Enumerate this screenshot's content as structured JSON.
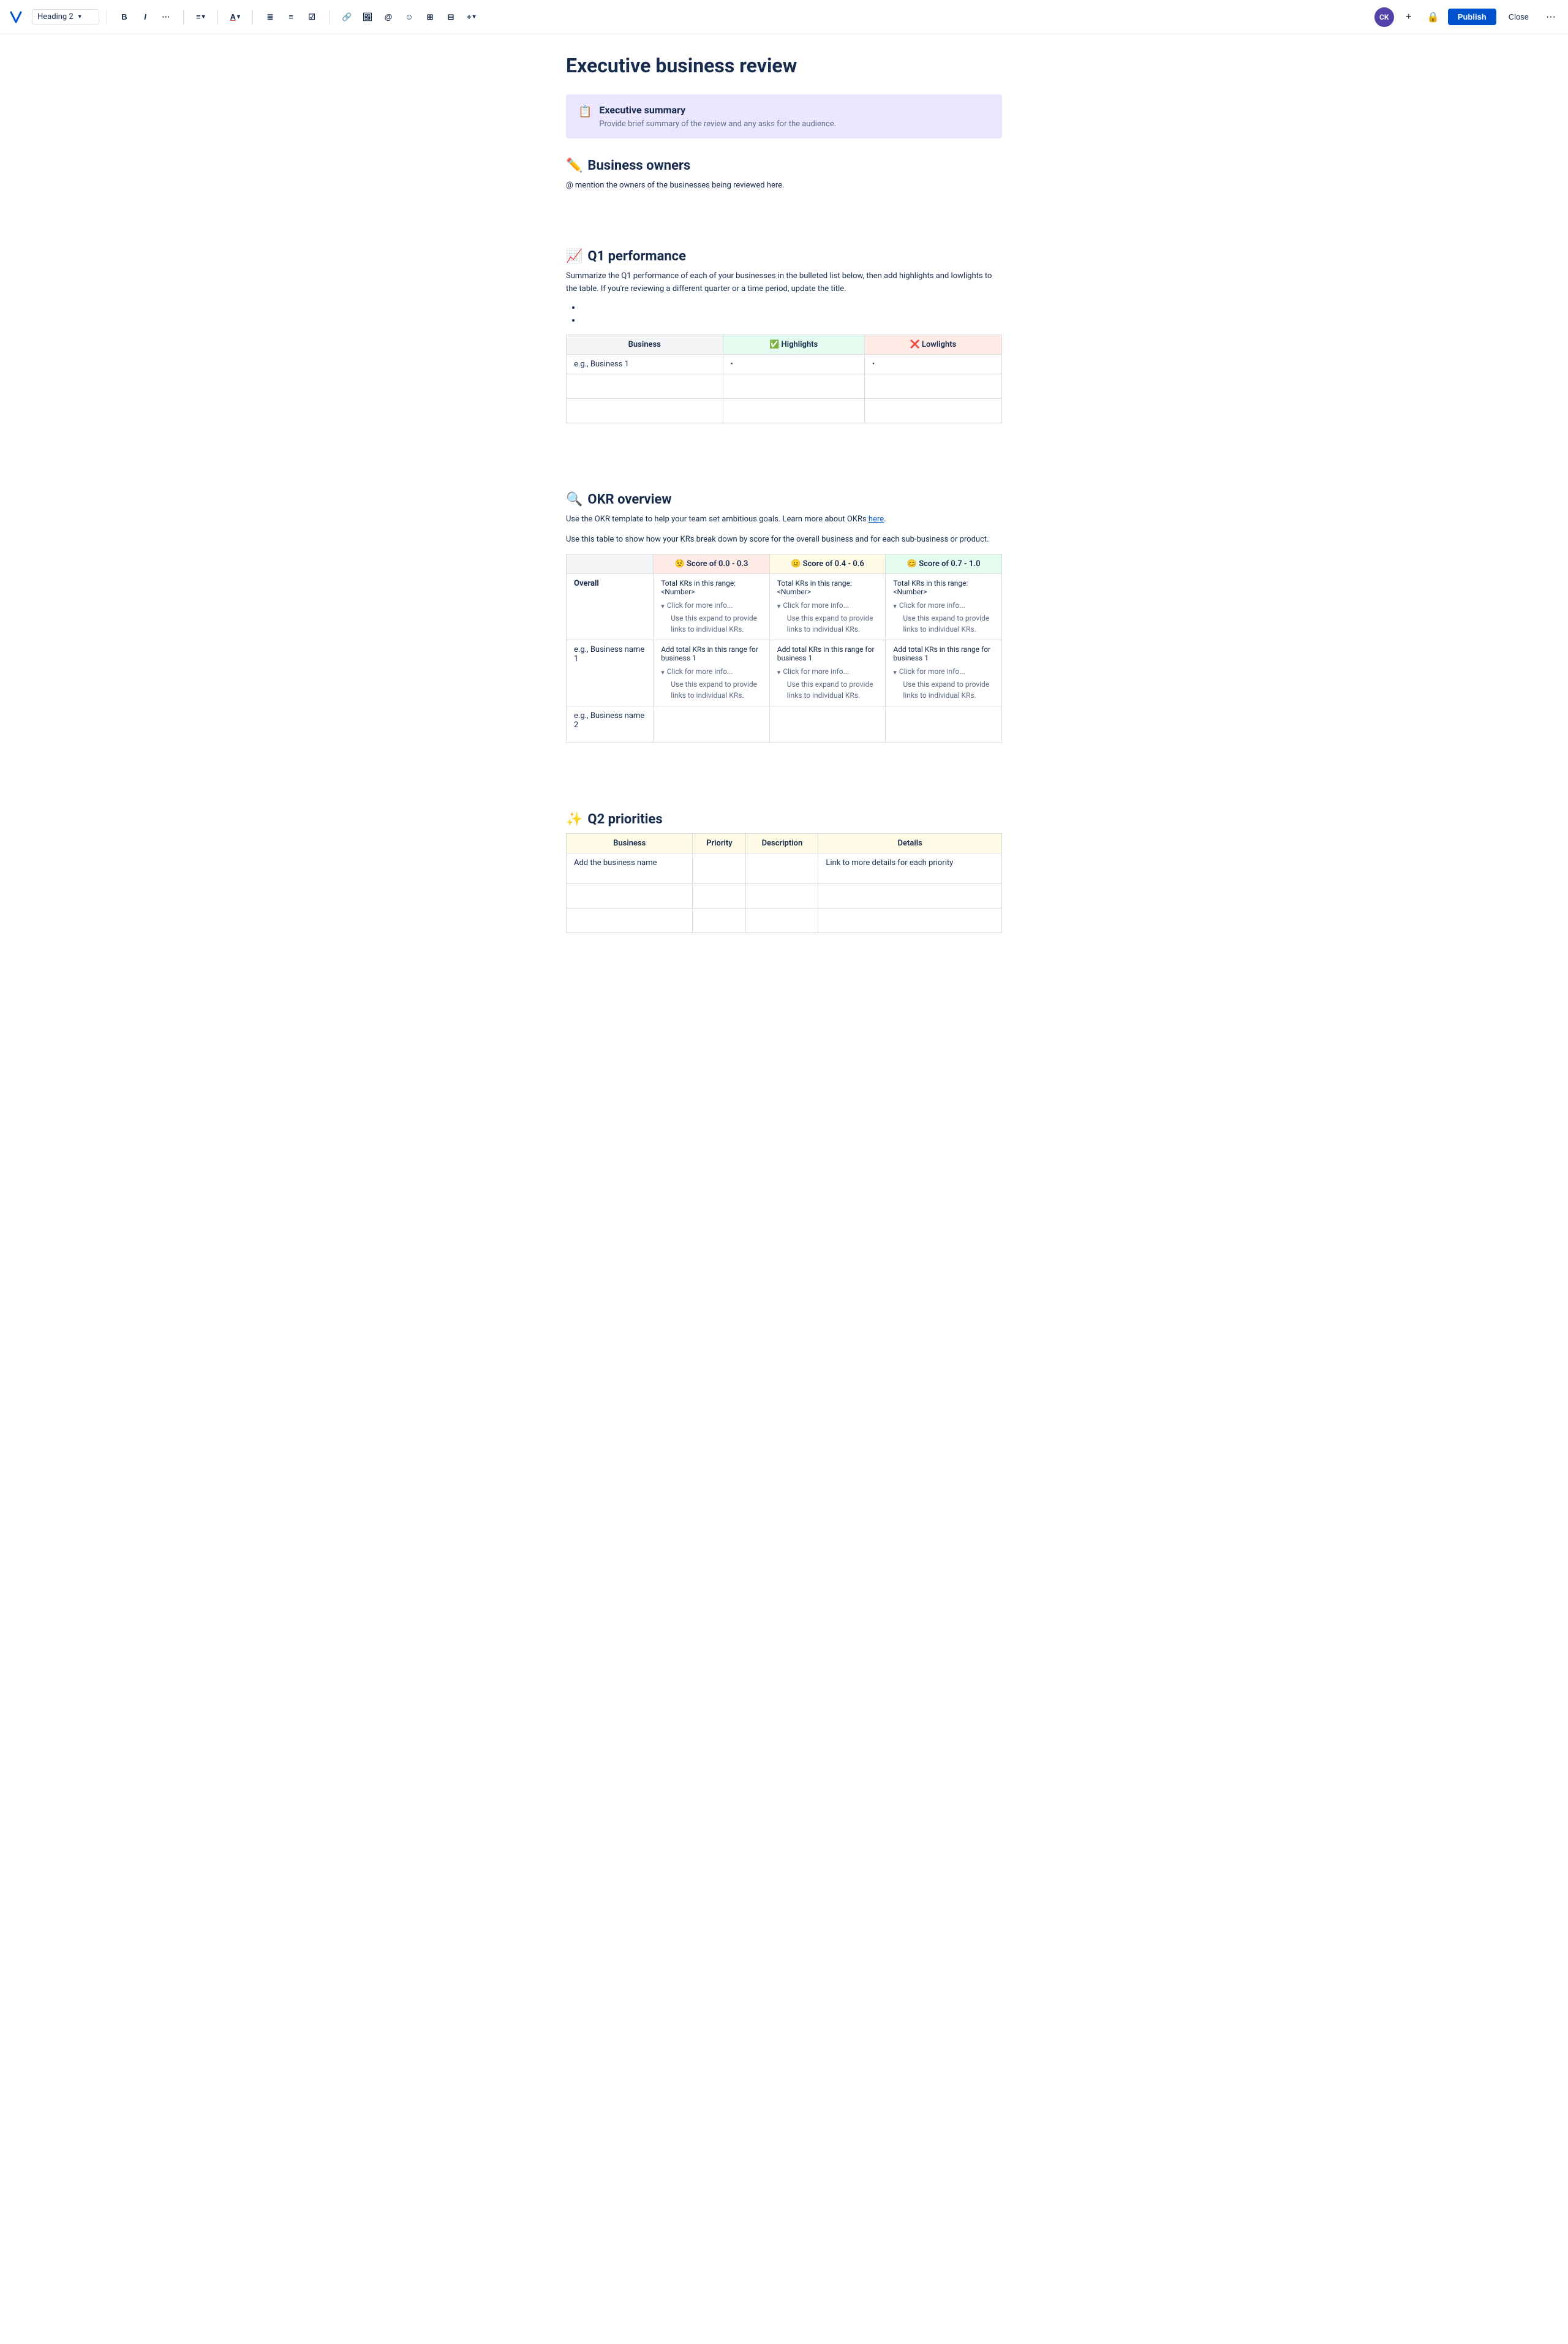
{
  "toolbar": {
    "heading_selector": "Heading 2",
    "bold": "B",
    "italic": "I",
    "more_text": "···",
    "align": "≡",
    "text_color": "A",
    "bullet_list": "≡",
    "numbered_list": "≡",
    "task": "☑",
    "link": "🔗",
    "image": "⬜",
    "mention": "@",
    "emoji": "☺",
    "table": "⊞",
    "layout": "⊟",
    "insert_more": "+",
    "avatar_text": "CK",
    "plus_btn": "+",
    "lock_icon": "🔒",
    "publish_label": "Publish",
    "close_label": "Close",
    "more_options": "···"
  },
  "document": {
    "title": "Executive business review",
    "sections": {
      "executive_summary": {
        "icon": "📋",
        "title": "Executive summary",
        "description": "Provide brief summary of the review and any asks for the audience."
      },
      "business_owners": {
        "icon": "✏️",
        "heading": "Business owners",
        "para": "@ mention the owners of the businesses being reviewed here."
      },
      "q1_performance": {
        "icon": "📈",
        "heading": "Q1 performance",
        "para1": "Summarize the Q1 performance of each of your businesses in the bulleted list below, then add highlights and lowlights to the table. If you're reviewing a different quarter or a time period, update the title.",
        "bullet_items": [
          "",
          ""
        ],
        "table": {
          "headers": [
            "Business",
            "✅ Highlights",
            "❌ Lowlights"
          ],
          "rows": [
            [
              "e.g., Business 1",
              "•",
              "•"
            ],
            [
              "",
              "",
              ""
            ],
            [
              "",
              "",
              ""
            ]
          ]
        }
      },
      "okr_overview": {
        "icon": "🔍",
        "heading": "OKR overview",
        "para1_text": "Use the OKR template to help your team set ambitious goals. Learn more about OKRs ",
        "para1_link": "here",
        "para1_suffix": ".",
        "para2": "Use this table to show how your KRs break down by score for the overall business and for each sub-business or product.",
        "table": {
          "col_headers": [
            "",
            "😟 Score of 0.0 - 0.3",
            "😐 Score of 0.4 - 0.6",
            "😊 Score of 0.7 - 1.0"
          ],
          "rows": [
            {
              "label": "Overall",
              "cells": [
                {
                  "main": "Total KRs in this range: <Number>",
                  "expand_label": "Click for more info...",
                  "expand_desc": "Use this expand to provide links to individual KRs."
                },
                {
                  "main": "Total KRs in this range: <Number>",
                  "expand_label": "Click for more info...",
                  "expand_desc": "Use this expand to provide links to individual KRs."
                },
                {
                  "main": "Total KRs in this range: <Number>",
                  "expand_label": "Click for more info...",
                  "expand_desc": "Use this expand to provide links to individual KRs."
                }
              ]
            },
            {
              "label": "e.g., Business name 1",
              "cells": [
                {
                  "main": "Add total KRs in this range for business 1",
                  "expand_label": "Click for more info...",
                  "expand_desc": "Use this expand to provide links to individual KRs."
                },
                {
                  "main": "Add total KRs in this range for business 1",
                  "expand_label": "Click for more info...",
                  "expand_desc": "Use this expand to provide links to individual KRs."
                },
                {
                  "main": "Add total KRs in this range for business 1",
                  "expand_label": "Click for more info...",
                  "expand_desc": "Use this expand to provide links to individual KRs."
                }
              ]
            },
            {
              "label": "e.g., Business name 2",
              "cells": [
                {
                  "main": "",
                  "expand_label": "",
                  "expand_desc": ""
                },
                {
                  "main": "",
                  "expand_label": "",
                  "expand_desc": ""
                },
                {
                  "main": "",
                  "expand_label": "",
                  "expand_desc": ""
                }
              ]
            }
          ]
        }
      },
      "q2_priorities": {
        "icon": "✨",
        "heading": "Q2 priorities",
        "table": {
          "headers": [
            "Business",
            "Priority",
            "Description",
            "Details"
          ],
          "rows": [
            [
              "Add the business name",
              "",
              "",
              "Link to more details for each priority"
            ],
            [
              "",
              "",
              "",
              ""
            ],
            [
              "",
              "",
              "",
              ""
            ]
          ]
        }
      }
    }
  }
}
